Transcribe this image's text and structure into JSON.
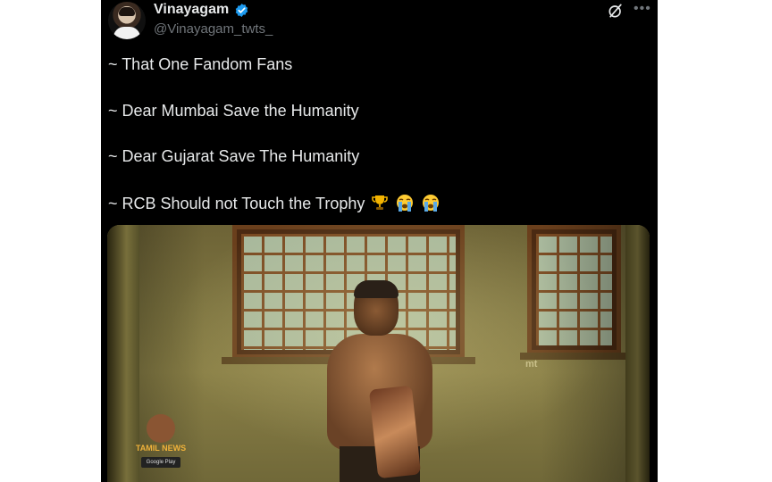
{
  "post": {
    "author_name": "Vinayagam",
    "handle": "@Vinayagam_twts_",
    "verified": true,
    "lines": [
      "~ That One Fandom Fans",
      "~ Dear Mumbai Save the Humanity",
      "~ Dear Gujarat Save The Humanity",
      "~ RCB Should not Touch the Trophy"
    ],
    "emojis": [
      "trophy-emoji",
      "crying-face-emoji",
      "crying-face-emoji"
    ]
  },
  "media": {
    "watermark": "mt",
    "channel_logo_text": "TAMIL NEWS",
    "badge_text": "Google Play"
  },
  "icons": {
    "verified": "verified-badge-icon",
    "grok": "grok-icon",
    "more": "more-options-icon"
  },
  "colors": {
    "background": "#000000",
    "text": "#e7e9ea",
    "secondary_text": "#71767b",
    "verified_blue": "#1d9bf0"
  }
}
